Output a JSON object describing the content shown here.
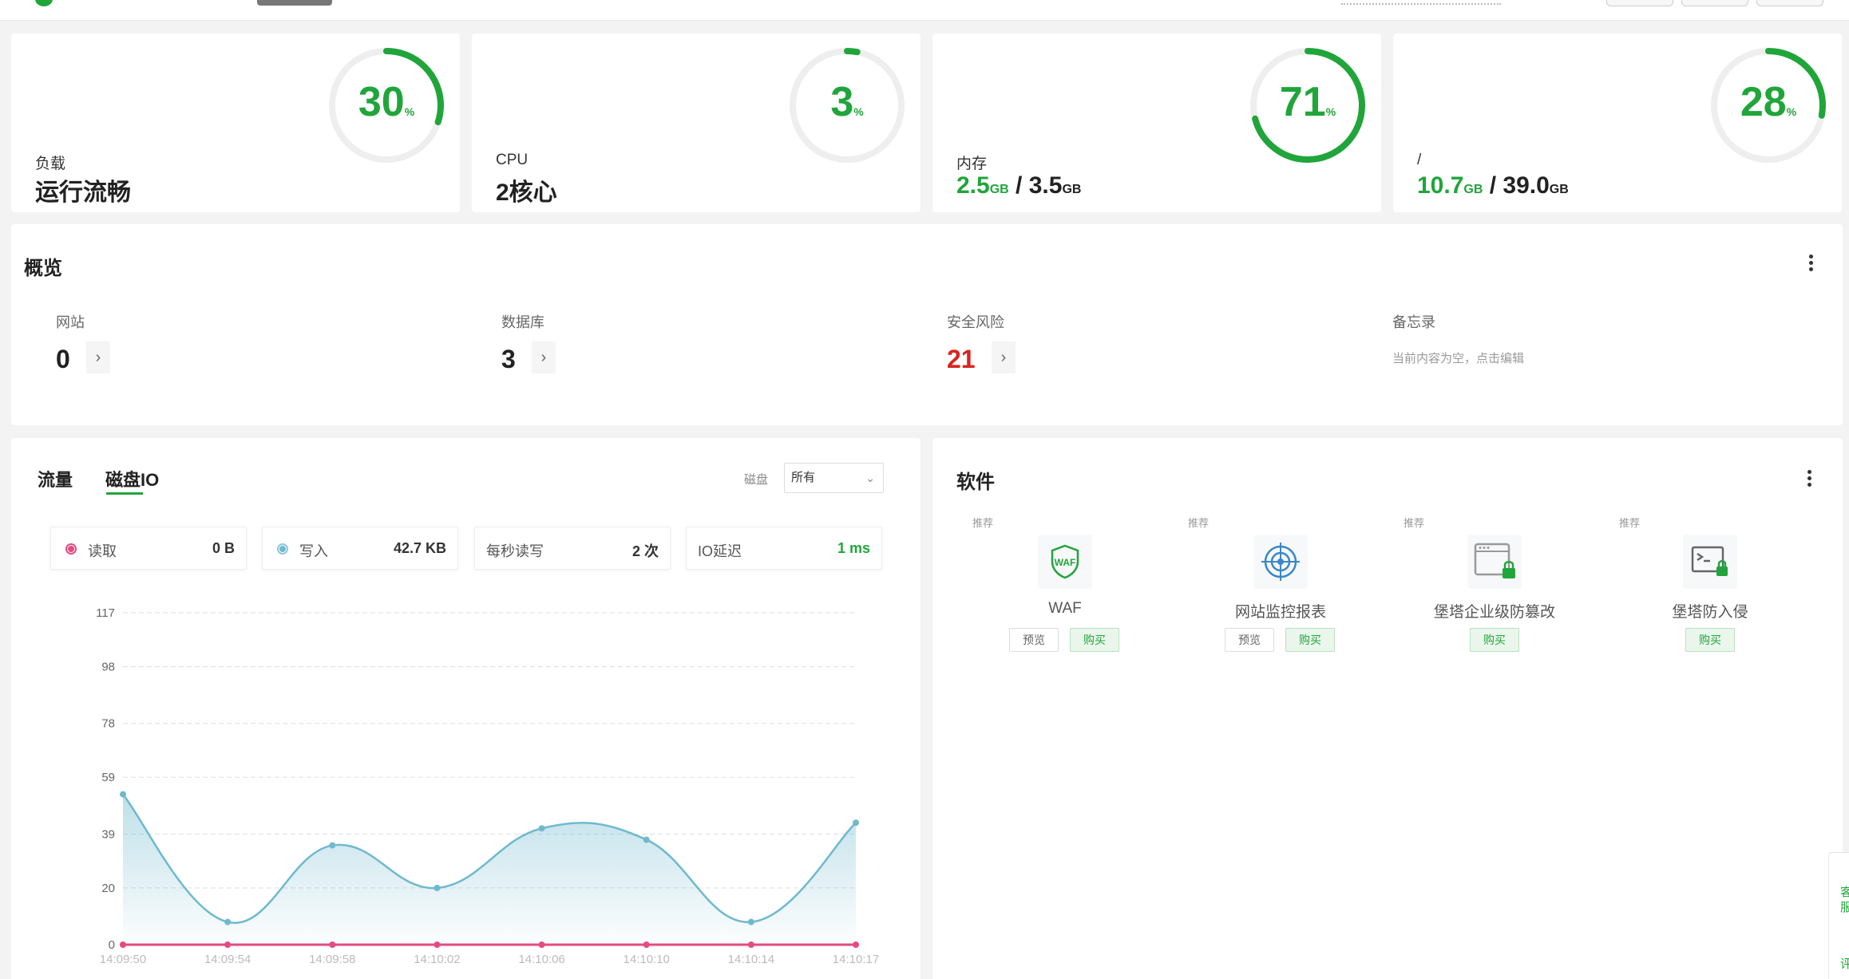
{
  "gauges": [
    {
      "name": "负载",
      "percent": 30,
      "percent_unit": "%",
      "value_text": "运行流畅"
    },
    {
      "name": "CPU",
      "percent": 3,
      "percent_unit": "%",
      "value_text": "2核心"
    },
    {
      "name": "内存",
      "percent": 71,
      "percent_unit": "%",
      "used": "2.5",
      "total": "3.5",
      "unit": "GB",
      "sep": " / "
    },
    {
      "name": "/",
      "percent": 28,
      "percent_unit": "%",
      "used": "10.7",
      "total": "39.0",
      "unit": "GB",
      "sep": " / "
    }
  ],
  "overview": {
    "title": "概览",
    "items": [
      {
        "label": "网站",
        "value": "0"
      },
      {
        "label": "数据库",
        "value": "3"
      },
      {
        "label": "安全风险",
        "value": "21"
      },
      {
        "label": "备忘录",
        "memo": "当前内容为空，点击编辑"
      }
    ],
    "arrow": "›"
  },
  "io_panel": {
    "tabs": [
      "流量",
      "磁盘IO"
    ],
    "active_tab": "磁盘IO",
    "disk_label": "磁盘",
    "disk_selected": "所有",
    "stats": [
      {
        "key": "读取",
        "value": "0 B"
      },
      {
        "key": "写入",
        "value": "42.7 KB"
      },
      {
        "key": "每秒读写",
        "value": "2 次"
      },
      {
        "key": "IO延迟",
        "value": "1 ms"
      }
    ]
  },
  "chart_data": {
    "type": "area",
    "x": [
      "14:09:50",
      "14:09:54",
      "14:09:58",
      "14:10:02",
      "14:10:06",
      "14:10:10",
      "14:10:14",
      "14:10:17"
    ],
    "yticks": [
      0,
      20,
      39,
      59,
      78,
      98,
      117
    ],
    "ylim": [
      0,
      117
    ],
    "grid": true,
    "series": [
      {
        "name": "写入",
        "values": [
          53,
          8,
          35,
          20,
          41,
          37,
          8,
          43
        ],
        "color": "#6fb9ce"
      },
      {
        "name": "读取",
        "values": [
          0,
          0,
          0,
          0,
          0,
          0,
          0,
          0
        ],
        "color": "#e54b7f"
      }
    ]
  },
  "software": {
    "title": "软件",
    "recommend_label": "推荐",
    "apps": [
      {
        "name": "WAF",
        "icon": "waf-shield-icon",
        "preview": "预览",
        "buy": "购买"
      },
      {
        "name": "网站监控报表",
        "icon": "monitor-target-icon",
        "preview": "预览",
        "buy": "购买"
      },
      {
        "name": "堡塔企业级防篡改",
        "icon": "tamper-lock-icon",
        "buy": "购买"
      },
      {
        "name": "堡塔防入侵",
        "icon": "terminal-lock-icon",
        "buy": "购买"
      }
    ],
    "icon_text": "WAF"
  },
  "side_float": {
    "service": "客服",
    "feedback": "评"
  },
  "colors": {
    "accent": "#20a53a",
    "danger": "#d9241f",
    "write": "#6fb9ce",
    "read": "#e54b7f"
  }
}
